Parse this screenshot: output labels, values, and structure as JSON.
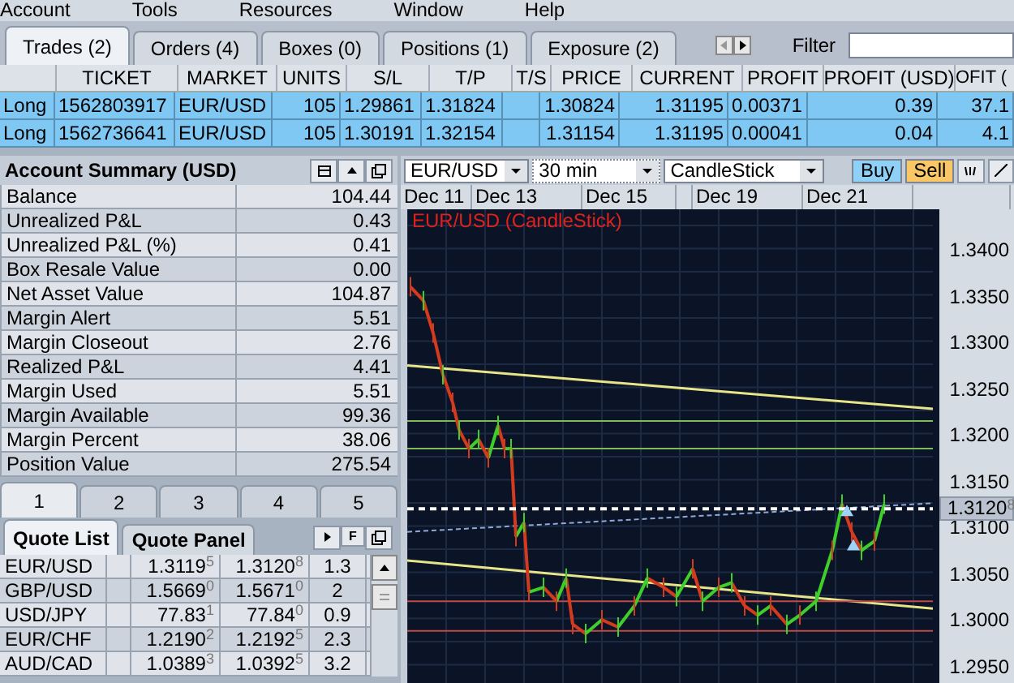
{
  "menu": [
    "Account",
    "Tools",
    "Resources",
    "Window",
    "Help"
  ],
  "trade_tabs": [
    {
      "label": "Trades (2)",
      "selected": true
    },
    {
      "label": "Orders (4)",
      "selected": false
    },
    {
      "label": "Boxes (0)",
      "selected": false
    },
    {
      "label": "Positions (1)",
      "selected": false
    },
    {
      "label": "Exposure (2)",
      "selected": false
    }
  ],
  "filter": {
    "label": "Filter"
  },
  "trades": {
    "columns": [
      "",
      "TICKET",
      "MARKET",
      "UNITS",
      "S/L",
      "T/P",
      "T/S",
      "PRICE",
      "CURRENT",
      "PROFIT",
      "PROFIT (USD)",
      "OFIT ("
    ],
    "rows": [
      [
        "Long",
        "1562803917",
        "EUR/USD",
        "105",
        "1.29861",
        "1.31824",
        "",
        "1.30824",
        "1.31195",
        "0.00371",
        "0.39",
        "37.1"
      ],
      [
        "Long",
        "1562736641",
        "EUR/USD",
        "105",
        "1.30191",
        "1.32154",
        "",
        "1.31154",
        "1.31195",
        "0.00041",
        "0.04",
        "4.1"
      ]
    ]
  },
  "account_summary": {
    "title": "Account Summary (USD)",
    "rows": [
      {
        "label": "Balance",
        "value": "104.44"
      },
      {
        "label": "Unrealized P&L",
        "value": "0.43"
      },
      {
        "label": "Unrealized P&L (%)",
        "value": "0.41"
      },
      {
        "label": "Box Resale Value",
        "value": "0.00"
      },
      {
        "label": "Net Asset Value",
        "value": "104.87"
      },
      {
        "label": "Margin Alert",
        "value": "5.51"
      },
      {
        "label": "Margin Closeout",
        "value": "2.76"
      },
      {
        "label": "Realized P&L",
        "value": "4.41"
      },
      {
        "label": "Margin Used",
        "value": "5.51"
      },
      {
        "label": "Margin Available",
        "value": "99.36"
      },
      {
        "label": "Margin Percent",
        "value": "38.06"
      },
      {
        "label": "Position Value",
        "value": "275.54"
      }
    ]
  },
  "page_tabs": [
    {
      "label": "1",
      "selected": true
    },
    {
      "label": "2",
      "selected": false
    },
    {
      "label": "3",
      "selected": false
    },
    {
      "label": "4",
      "selected": false
    },
    {
      "label": "5",
      "selected": false
    }
  ],
  "quote_tabs": [
    {
      "label": "Quote List",
      "selected": true
    },
    {
      "label": "Quote Panel",
      "selected": false
    }
  ],
  "quote_panel_button": "F",
  "quotes": [
    {
      "pair": "EUR/USD",
      "bid": "1.3119$^{5}$",
      "ask": "1.3120$^{8}$",
      "spread": "1.3"
    },
    {
      "pair": "GBP/USD",
      "bid": "1.5669$^{0}$",
      "ask": "1.5671$^{0}$",
      "spread": "2"
    },
    {
      "pair": "USD/JPY",
      "bid": "77.83$^{1}$",
      "ask": "77.84$^{0}$",
      "spread": "0.9"
    },
    {
      "pair": "EUR/CHF",
      "bid": "1.2190$^{2}$",
      "ask": "1.2192$^{5}$",
      "spread": "2.3"
    },
    {
      "pair": "AUD/CAD",
      "bid": "1.0389$^{3}$",
      "ask": "1.0392$^{5}$",
      "spread": "3.2"
    }
  ],
  "chart": {
    "instrument": "EUR/USD",
    "timeframe": "30 min",
    "chart_type": "CandleStick",
    "buy": "Buy",
    "sell": "Sell",
    "dates": [
      "Dec 11",
      "Dec 13",
      "Dec 15",
      "Dec 19",
      "Dec 21"
    ],
    "title": "EUR/USD (CandleStick)",
    "price_labels": [
      "1.3400",
      "1.3350",
      "1.3300",
      "1.3250",
      "1.3200",
      "1.3150",
      "1.3100",
      "1.3050",
      "1.3000",
      "1.2950"
    ],
    "current_price": "1.3120$^{8}$"
  }
}
